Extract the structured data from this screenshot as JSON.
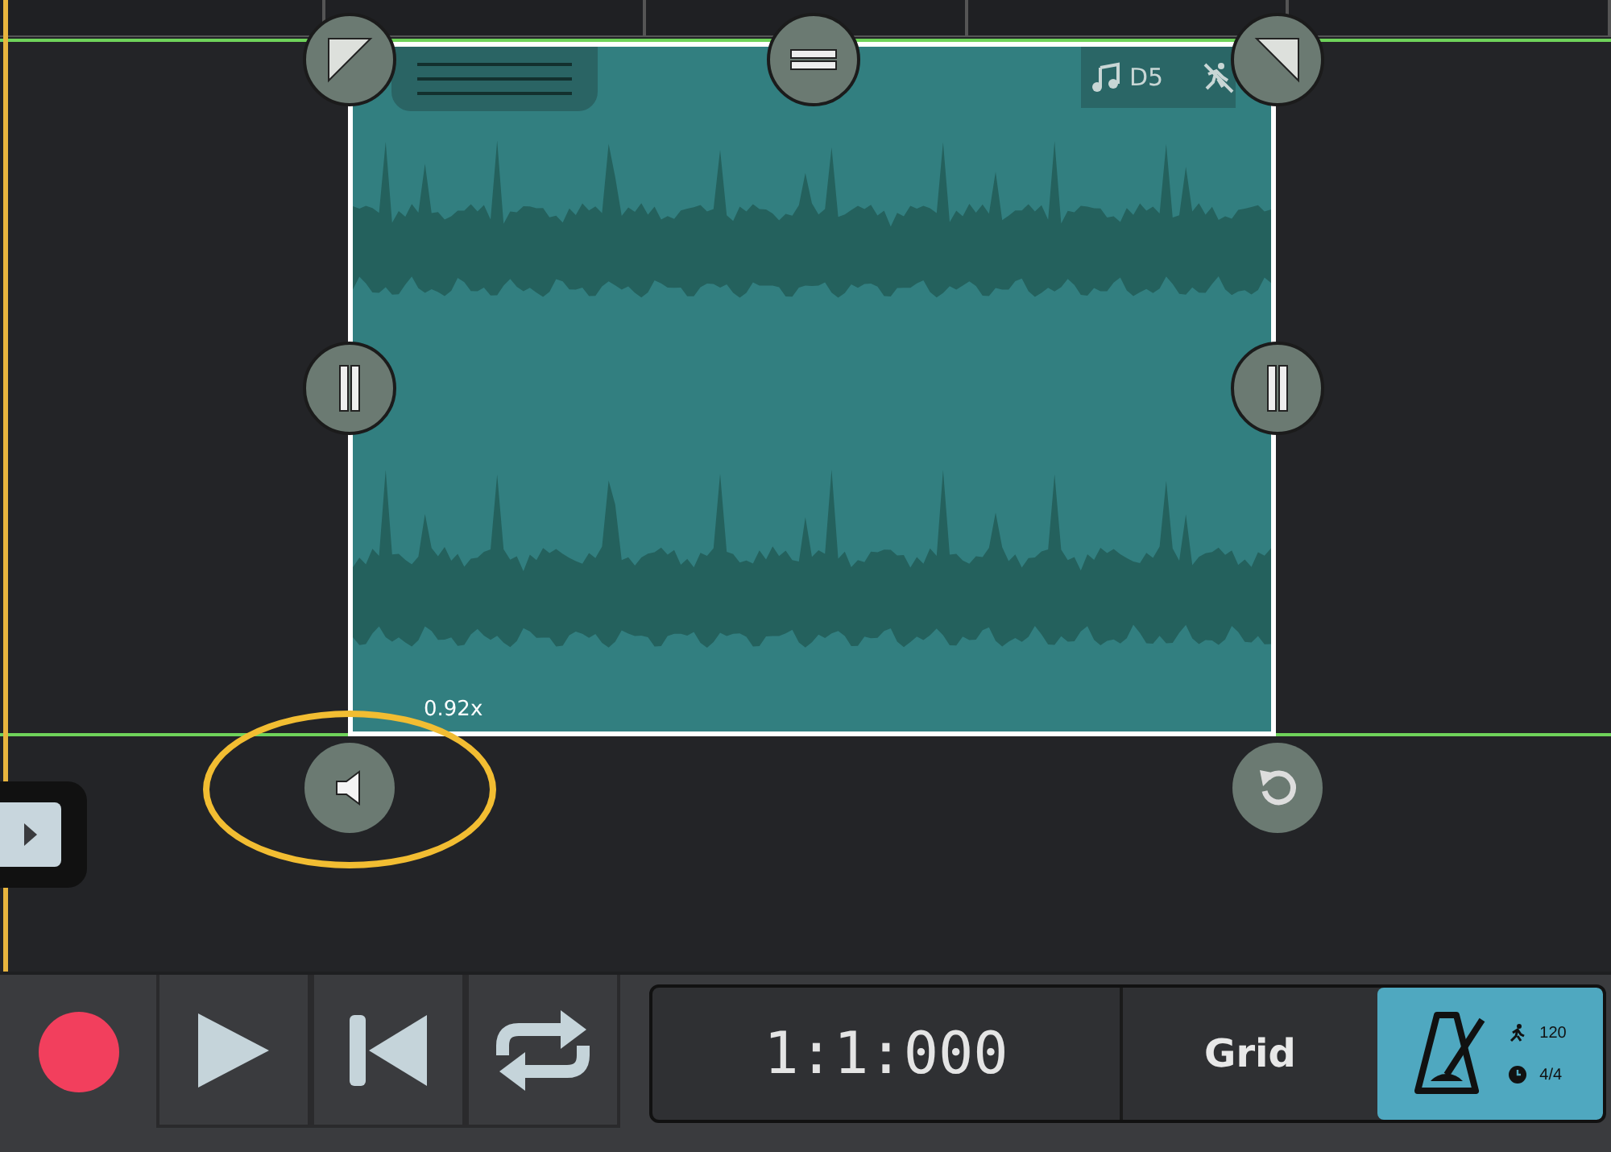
{
  "clip": {
    "pitch": "D5",
    "speed": "0.92x",
    "volume_highlighted": true
  },
  "transport": {
    "time": "1:1:000",
    "snap": "Grid",
    "tempo": "120",
    "signature": "4/4"
  }
}
